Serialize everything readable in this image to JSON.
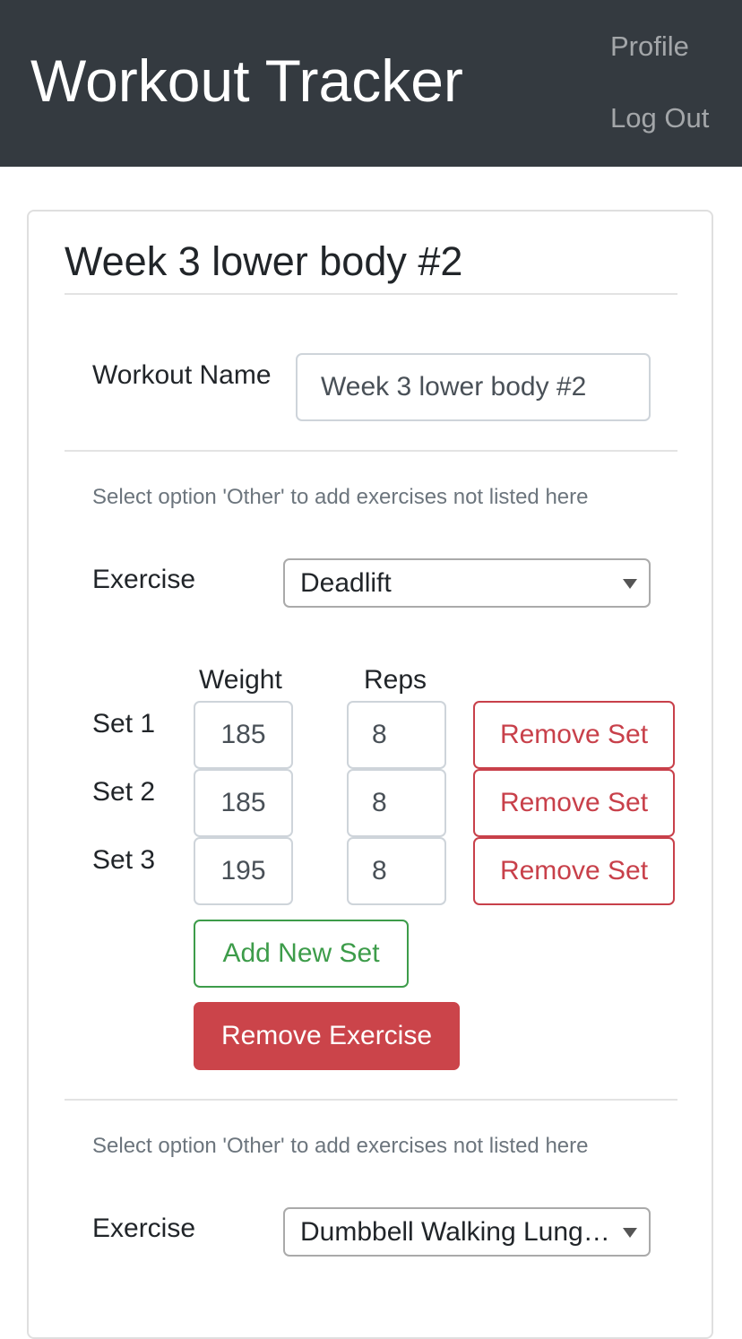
{
  "navbar": {
    "brand": "Workout Tracker",
    "links": [
      "Profile",
      "Log Out"
    ]
  },
  "workout": {
    "title": "Week 3 lower body #2",
    "name_label": "Workout Name",
    "name_value": "Week 3 lower body #2"
  },
  "exercises": [
    {
      "helper": "Select option 'Other' to add exercises not listed here",
      "label": "Exercise",
      "selected": "Deadlift",
      "headers": {
        "weight": "Weight",
        "reps": "Reps"
      },
      "sets": [
        {
          "label": "Set 1",
          "weight": "185",
          "reps": "8",
          "remove": "Remove Set"
        },
        {
          "label": "Set 2",
          "weight": "185",
          "reps": "8",
          "remove": "Remove Set"
        },
        {
          "label": "Set 3",
          "weight": "195",
          "reps": "8",
          "remove": "Remove Set"
        }
      ],
      "add_set": "Add New Set",
      "remove_exercise": "Remove Exercise"
    },
    {
      "helper": "Select option 'Other' to add exercises not listed here",
      "label": "Exercise",
      "selected": "Dumbbell Walking Lunges"
    }
  ],
  "colors": {
    "navbar_bg": "#343a40",
    "danger": "#cb444a",
    "success": "#3d9c4a",
    "muted": "#6c757d"
  }
}
